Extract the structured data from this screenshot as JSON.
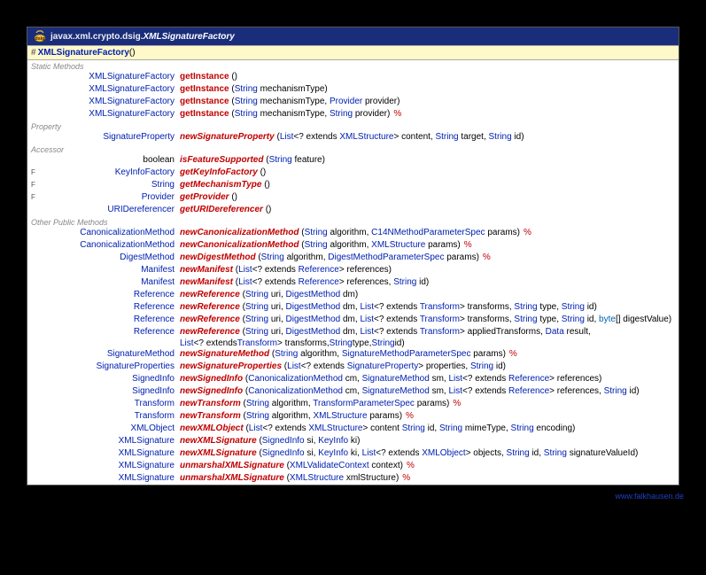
{
  "header": {
    "package": "javax.xml.crypto.dsig.",
    "className": "XMLSignatureFactory"
  },
  "constructor": {
    "name": "XMLSignatureFactory",
    "params": "()"
  },
  "sections": [
    {
      "title": "Static Methods",
      "rows": [
        {
          "flag": "",
          "ret": "XMLSignatureFactory",
          "retLink": true,
          "name": "getInstance",
          "italic": false,
          "params": "()",
          "throws": false
        },
        {
          "flag": "",
          "ret": "XMLSignatureFactory",
          "retLink": true,
          "name": "getInstance",
          "italic": false,
          "params": "(<t>String</t> mechanismType)",
          "throws": false
        },
        {
          "flag": "",
          "ret": "XMLSignatureFactory",
          "retLink": true,
          "name": "getInstance",
          "italic": false,
          "params": "(<t>String</t> mechanismType, <t>Provider</t> provider)",
          "throws": false
        },
        {
          "flag": "",
          "ret": "XMLSignatureFactory",
          "retLink": true,
          "name": "getInstance",
          "italic": false,
          "params": "(<t>String</t> mechanismType, <t>String</t> provider)",
          "throws": true
        }
      ]
    },
    {
      "title": "Property",
      "rows": [
        {
          "flag": "",
          "ret": "SignatureProperty",
          "retLink": true,
          "name": "newSignatureProperty",
          "italic": true,
          "params": "(<t>List</t><? extends <t>XMLStructure</t>> content, <t>String</t> target, <t>String</t> id)",
          "throws": false
        }
      ]
    },
    {
      "title": "Accessor",
      "rows": [
        {
          "flag": "",
          "ret": "boolean",
          "retLink": false,
          "name": "isFeatureSupported",
          "italic": true,
          "params": "(<t>String</t> feature)",
          "throws": false
        },
        {
          "flag": "F",
          "ret": "KeyInfoFactory",
          "retLink": true,
          "name": "getKeyInfoFactory",
          "italic": true,
          "params": "()",
          "throws": false
        },
        {
          "flag": "F",
          "ret": "String",
          "retLink": true,
          "name": "getMechanismType",
          "italic": true,
          "params": "()",
          "throws": false
        },
        {
          "flag": "F",
          "ret": "Provider",
          "retLink": true,
          "name": "getProvider",
          "italic": true,
          "params": "()",
          "throws": false
        },
        {
          "flag": "",
          "ret": "URIDereferencer",
          "retLink": true,
          "name": "getURIDereferencer",
          "italic": true,
          "params": "()",
          "throws": false
        }
      ]
    },
    {
      "title": "Other Public Methods",
      "rows": [
        {
          "flag": "",
          "ret": "CanonicalizationMethod",
          "retLink": true,
          "name": "newCanonicalizationMethod",
          "italic": true,
          "params": "(<t>String</t> algorithm, <t>C14NMethodParameterSpec</t> params)",
          "throws": true
        },
        {
          "flag": "",
          "ret": "CanonicalizationMethod",
          "retLink": true,
          "name": "newCanonicalizationMethod",
          "italic": true,
          "params": "(<t>String</t> algorithm, <t>XMLStructure</t> params)",
          "throws": true
        },
        {
          "flag": "",
          "ret": "DigestMethod",
          "retLink": true,
          "name": "newDigestMethod",
          "italic": true,
          "params": "(<t>String</t> algorithm, <t>DigestMethodParameterSpec</t> params)",
          "throws": true
        },
        {
          "flag": "",
          "ret": "Manifest",
          "retLink": true,
          "name": "newManifest",
          "italic": true,
          "params": "(<t>List</t><? extends <t>Reference</t>> references)",
          "throws": false
        },
        {
          "flag": "",
          "ret": "Manifest",
          "retLink": true,
          "name": "newManifest",
          "italic": true,
          "params": "(<t>List</t><? extends <t>Reference</t>> references, <t>String</t> id)",
          "throws": false
        },
        {
          "flag": "",
          "ret": "Reference",
          "retLink": true,
          "name": "newReference",
          "italic": true,
          "params": "(<t>String</t> uri, <t>DigestMethod</t> dm)",
          "throws": false
        },
        {
          "flag": "",
          "ret": "Reference",
          "retLink": true,
          "name": "newReference",
          "italic": true,
          "params": "(<t>String</t> uri, <t>DigestMethod</t> dm, <t>List</t><? extends <t>Transform</t>> transforms, <t>String</t> type, <t>String</t> id)",
          "throws": false
        },
        {
          "flag": "",
          "ret": "Reference",
          "retLink": true,
          "name": "newReference",
          "italic": true,
          "params": "(<t>String</t> uri, <t>DigestMethod</t> dm, <t>List</t><? extends <t>Transform</t>> transforms, <t>String</t> type, <t>String</t> id, <p>byte</p>[] digestValue)",
          "throws": false
        },
        {
          "flag": "",
          "ret": "Reference",
          "retLink": true,
          "name": "newReference",
          "italic": true,
          "params": "(<t>String</t> uri, <t>DigestMethod</t> dm, <t>List</t><? extends <t>Transform</t>> appliedTransforms, <t>Data</t> result,",
          "throws": false,
          "continuation": "<t>List</t><? extends <t>Transform</t>> transforms, <t>String</t> type, <t>String</t> id)"
        },
        {
          "flag": "",
          "ret": "SignatureMethod",
          "retLink": true,
          "name": "newSignatureMethod",
          "italic": true,
          "params": "(<t>String</t> algorithm, <t>SignatureMethodParameterSpec</t> params)",
          "throws": true
        },
        {
          "flag": "",
          "ret": "SignatureProperties",
          "retLink": true,
          "name": "newSignatureProperties",
          "italic": true,
          "params": "(<t>List</t><? extends <t>SignatureProperty</t>> properties, <t>String</t> id)",
          "throws": false
        },
        {
          "flag": "",
          "ret": "SignedInfo",
          "retLink": true,
          "name": "newSignedInfo",
          "italic": true,
          "params": "(<t>CanonicalizationMethod</t> cm, <t>SignatureMethod</t> sm, <t>List</t><? extends <t>Reference</t>> references)",
          "throws": false
        },
        {
          "flag": "",
          "ret": "SignedInfo",
          "retLink": true,
          "name": "newSignedInfo",
          "italic": true,
          "params": "(<t>CanonicalizationMethod</t> cm, <t>SignatureMethod</t> sm, <t>List</t><? extends <t>Reference</t>> references, <t>String</t> id)",
          "throws": false
        },
        {
          "flag": "",
          "ret": "Transform",
          "retLink": true,
          "name": "newTransform",
          "italic": true,
          "params": "(<t>String</t> algorithm, <t>TransformParameterSpec</t> params)",
          "throws": true
        },
        {
          "flag": "",
          "ret": "Transform",
          "retLink": true,
          "name": "newTransform",
          "italic": true,
          "params": "(<t>String</t> algorithm, <t>XMLStructure</t> params)",
          "throws": true
        },
        {
          "flag": "",
          "ret": "XMLObject",
          "retLink": true,
          "name": "newXMLObject",
          "italic": true,
          "params": "(<t>List</t><? extends <t>XMLStructure</t>> content <t>String</t> id, <t>String</t> mimeType, <t>String</t> encoding)",
          "throws": false
        },
        {
          "flag": "",
          "ret": "XMLSignature",
          "retLink": true,
          "name": "newXMLSignature",
          "italic": true,
          "params": "(<t>SignedInfo</t> si, <t>KeyInfo</t> ki)",
          "throws": false
        },
        {
          "flag": "",
          "ret": "XMLSignature",
          "retLink": true,
          "name": "newXMLSignature",
          "italic": true,
          "params": "(<t>SignedInfo</t> si, <t>KeyInfo</t> ki, <t>List</t><? extends <t>XMLObject</t>> objects, <t>String</t> id, <t>String</t> signatureValueId)",
          "throws": false
        },
        {
          "flag": "",
          "ret": "XMLSignature",
          "retLink": true,
          "name": "unmarshalXMLSignature",
          "italic": true,
          "params": "(<t>XMLValidateContext</t> context)",
          "throws": true
        },
        {
          "flag": "",
          "ret": "XMLSignature",
          "retLink": true,
          "name": "unmarshalXMLSignature",
          "italic": true,
          "params": "(<t>XMLStructure</t> xmlStructure)",
          "throws": true
        }
      ]
    }
  ],
  "footerLink": "www.falkhausen.de"
}
